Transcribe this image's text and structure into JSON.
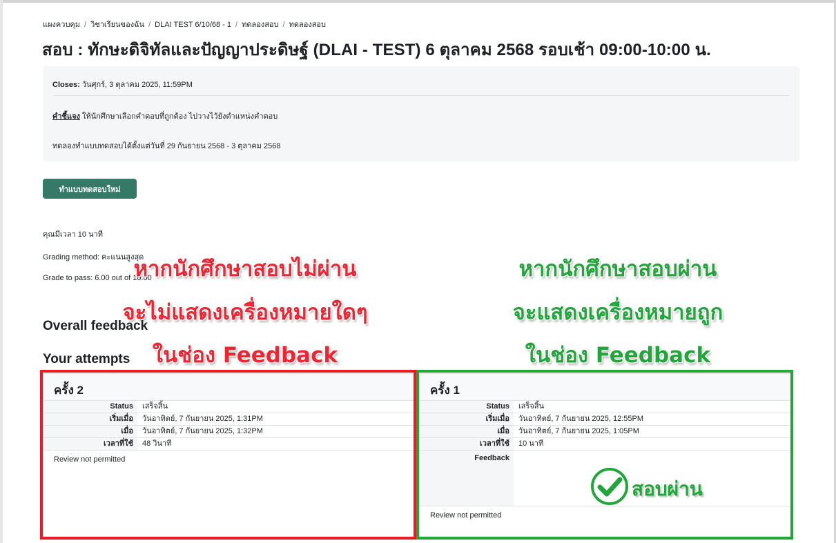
{
  "breadcrumb": [
    "แผงควบคุม",
    "วิชาเรียนของฉัน",
    "DLAI TEST 6/10/68 - 1",
    "ทดลองสอบ",
    "ทดลองสอบ"
  ],
  "page_title": "สอบ : ทักษะดิจิทัลและปัญญาประดิษฐ์ (DLAI - TEST) 6 ตุลาคม 2568 รอบเช้า 09:00-10:00 น.",
  "info": {
    "closes_label": "Closes:",
    "closes_value": "วันศุกร์, 3 ตุลาคม 2025, 11:59PM",
    "intro_label": "คำชี้แจง",
    "intro_text": "ให้นักศึกษาเลือกคำตอบที่ถูกต้อง ไปวางไว้ยังตำแหน่งคำตอบ",
    "period_text": "ทดลองทำแบบทดสอบได้ตั้งแต่วันที่ 29 กันยายน 2568 - 3 ตุลาคม 2568"
  },
  "attempt_button": "ทำแบบทดสอบใหม่",
  "meta": {
    "time_limit": "คุณมีเวลา 10 นาที",
    "grading_method": "Grading method: คะแนนสูงสุด",
    "grade_to_pass": "Grade to pass: 6.00 out of 10.00"
  },
  "headings": {
    "overall_feedback": "Overall feedback",
    "your_attempts": "Your attempts"
  },
  "labels": {
    "status": "Status",
    "started": "เริ่มเมื่อ",
    "completed": "เมื่อ",
    "duration": "เวลาที่ใช้",
    "feedback": "Feedback",
    "review": "Review not permitted"
  },
  "attempts": [
    {
      "title": "ครั้ง 2",
      "status": "เสร็จสิ้น",
      "started": "วันอาทิตย์, 7 กันยายน 2025, 1:31PM",
      "completed": "วันอาทิตย์, 7 กันยายน 2025, 1:32PM",
      "duration": "48 วินาที"
    },
    {
      "title": "ครั้ง 1",
      "status": "เสร็จสิ้น",
      "started": "วันอาทิตย์, 7 กันยายน 2025, 12:55PM",
      "completed": "วันอาทิตย์, 7 กันยายน 2025, 1:05PM",
      "duration": "10 นาที"
    }
  ],
  "annotations": {
    "fail": [
      "หากนักศึกษาสอบไม่ผ่าน",
      "จะไม่แสดงเครื่องหมายใดๆ",
      "ในช่อง Feedback"
    ],
    "pass": [
      "หากนักศึกษาสอบผ่าน",
      "จะแสดงเครื่องหมายถูก",
      "ในช่อง Feedback"
    ],
    "pass_stamp": "สอบผ่าน"
  },
  "colors": {
    "button": "#357a67",
    "fail_highlight": "#e61d25",
    "pass_highlight": "#22a63b"
  },
  "icons": {
    "pass_stamp": "check-circle-icon"
  }
}
